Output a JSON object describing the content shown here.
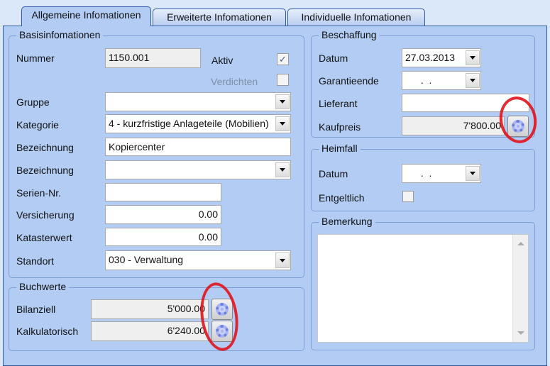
{
  "tabs": [
    "Allgemeine Infomationen",
    "Erweiterte Infomationen",
    "Individuelle Infomationen"
  ],
  "basis": {
    "title": "Basisinfomationen",
    "nummer_label": "Nummer",
    "nummer": "1150.001",
    "aktiv_label": "Aktiv",
    "aktiv_checked": "✓",
    "verdichten_label": "Verdichten",
    "gruppe_label": "Gruppe",
    "gruppe": "",
    "kategorie_label": "Kategorie",
    "kategorie": "4 - kurzfristige Anlageteile (Mobilien)",
    "bezeichnung_label": "Bezeichnung",
    "bezeichnung": "Kopiercenter",
    "bezeichnung2_label": "Bezeichnung",
    "bezeichnung2": "",
    "serien_label": "Serien-Nr.",
    "serien": "",
    "versicherung_label": "Versicherung",
    "versicherung": "0.00",
    "kataster_label": "Katasterwert",
    "kataster": "0.00",
    "standort_label": "Standort",
    "standort": "030 - Verwaltung"
  },
  "buchwerte": {
    "title": "Buchwerte",
    "bilanziell_label": "Bilanziell",
    "bilanziell": "5'000.00",
    "kalk_label": "Kalkulatorisch",
    "kalk": "6'240.00"
  },
  "beschaffung": {
    "title": "Beschaffung",
    "datum_label": "Datum",
    "datum": "27.03.2013",
    "garantie_label": "Garantieende",
    "garantie": " .  .",
    "lieferant_label": "Lieferant",
    "lieferant": "",
    "kaufpreis_label": "Kaufpreis",
    "kaufpreis": "7'800.00"
  },
  "heimfall": {
    "title": "Heimfall",
    "datum_label": "Datum",
    "datum": " .  .",
    "entgeltlich_label": "Entgeltlich"
  },
  "bemerkung": {
    "title": "Bemerkung",
    "text": ""
  }
}
